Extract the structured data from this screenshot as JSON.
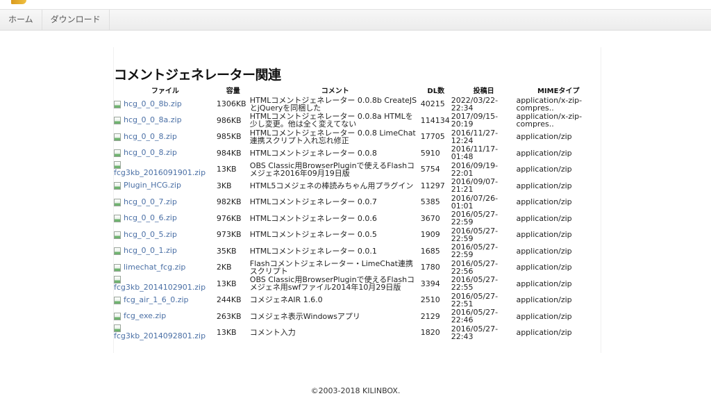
{
  "nav": {
    "items": [
      {
        "label": "ホーム"
      },
      {
        "label": "ダウンロード"
      }
    ]
  },
  "page": {
    "title": "コメントジェネレーター関連"
  },
  "table": {
    "headers": {
      "file": "ファイル",
      "size": "容量",
      "comment": "コメント",
      "dl": "DL数",
      "date": "投稿日",
      "mime": "MIMEタイプ"
    },
    "rows": [
      {
        "file": "hcg_0_0_8b.zip",
        "size": "1306KB",
        "comment": "HTMLコメントジェネレーター 0.0.8b CreateJSとjQueryを同梱した",
        "dl": "40215",
        "date": "2022/03/22-22:34",
        "mime": "application/x-zip-compres..",
        "stack": false
      },
      {
        "file": "hcg_0_0_8a.zip",
        "size": "986KB",
        "comment": "HTMLコメントジェネレーター 0.0.8a HTMLを少し変更。他は全く変えてない",
        "dl": "114134",
        "date": "2017/09/15-20:19",
        "mime": "application/x-zip-compres..",
        "stack": false
      },
      {
        "file": "hcg_0_0_8.zip",
        "size": "985KB",
        "comment": "HTMLコメントジェネレーター 0.0.8 LimeChat連携スクリプト入れ忘れ修正",
        "dl": "17705",
        "date": "2016/11/27-12:24",
        "mime": "application/zip",
        "stack": false
      },
      {
        "file": "hcg_0_0_8.zip",
        "size": "984KB",
        "comment": "HTMLコメントジェネレーター 0.0.8",
        "dl": "5910",
        "date": "2016/11/17-01:48",
        "mime": "application/zip",
        "stack": false
      },
      {
        "file": "fcg3kb_2016091901.zip",
        "size": "13KB",
        "comment": "OBS Classic用BrowserPluginで使えるFlashコメジェネ2016年09月19日版",
        "dl": "5754",
        "date": "2016/09/19-22:01",
        "mime": "application/zip",
        "stack": true
      },
      {
        "file": "Plugin_HCG.zip",
        "size": "3KB",
        "comment": "HTML5コメジェネの棒読みちゃん用プラグイン",
        "dl": "11297",
        "date": "2016/09/07-21:21",
        "mime": "application/zip",
        "stack": false
      },
      {
        "file": "hcg_0_0_7.zip",
        "size": "982KB",
        "comment": "HTMLコメントジェネレーター 0.0.7",
        "dl": "5385",
        "date": "2016/07/26-01:01",
        "mime": "application/zip",
        "stack": false
      },
      {
        "file": "hcg_0_0_6.zip",
        "size": "976KB",
        "comment": "HTMLコメントジェネレーター 0.0.6",
        "dl": "3670",
        "date": "2016/05/27-22:59",
        "mime": "application/zip",
        "stack": false
      },
      {
        "file": "hcg_0_0_5.zip",
        "size": "973KB",
        "comment": "HTMLコメントジェネレーター 0.0.5",
        "dl": "1909",
        "date": "2016/05/27-22:59",
        "mime": "application/zip",
        "stack": false
      },
      {
        "file": "hcg_0_0_1.zip",
        "size": "35KB",
        "comment": "HTMLコメントジェネレーター 0.0.1",
        "dl": "1685",
        "date": "2016/05/27-22:59",
        "mime": "application/zip",
        "stack": false
      },
      {
        "file": "limechat_fcg.zip",
        "size": "2KB",
        "comment": "Flashコメントジェネレーター・LimeChat連携スクリプト",
        "dl": "1780",
        "date": "2016/05/27-22:56",
        "mime": "application/zip",
        "stack": false
      },
      {
        "file": "fcg3kb_2014102901.zip",
        "size": "13KB",
        "comment": "OBS Classic用BrowserPluginで使えるFlashコメジェネ用swfファイル2014年10月29日版",
        "dl": "3394",
        "date": "2016/05/27-22:55",
        "mime": "application/zip",
        "stack": true
      },
      {
        "file": "fcg_air_1_6_0.zip",
        "size": "244KB",
        "comment": "コメジェネAIR 1.6.0",
        "dl": "2510",
        "date": "2016/05/27-22:51",
        "mime": "application/zip",
        "stack": false
      },
      {
        "file": "fcg_exe.zip",
        "size": "263KB",
        "comment": "コメジェネ表示Windowsアプリ",
        "dl": "2129",
        "date": "2016/05/27-22:46",
        "mime": "application/zip",
        "stack": false
      },
      {
        "file": "fcg3kb_2014092801.zip",
        "size": "13KB",
        "comment": "コメント入力",
        "dl": "1820",
        "date": "2016/05/27-22:43",
        "mime": "application/zip",
        "stack": true
      }
    ]
  },
  "footer": {
    "copyright": "©2003-2018 KILINBOX."
  }
}
